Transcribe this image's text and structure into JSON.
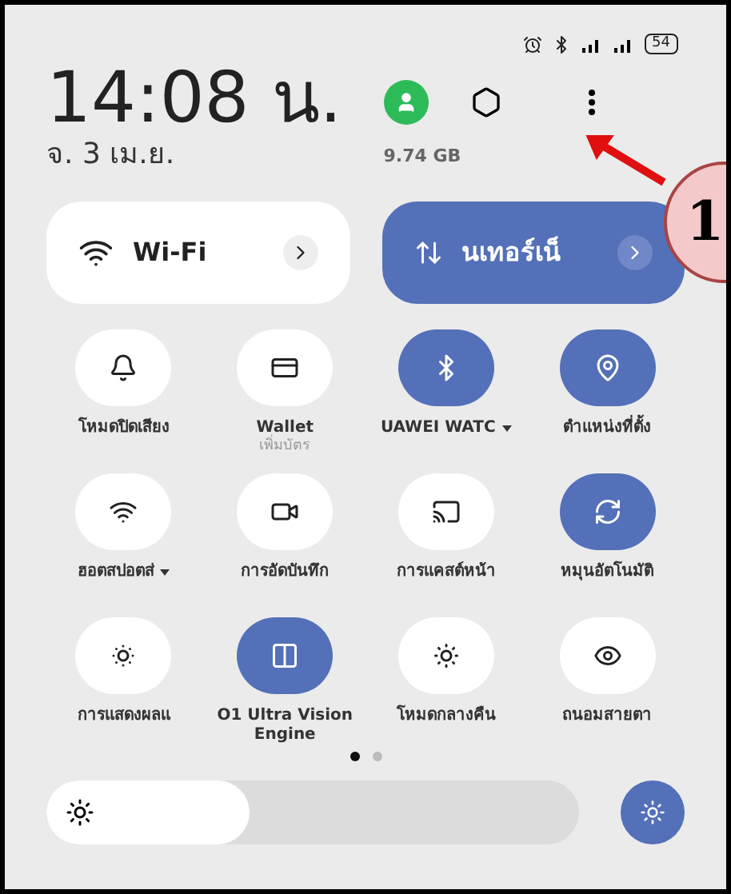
{
  "status_bar": {
    "battery": "54"
  },
  "header": {
    "time": "14:08 น.",
    "date": "จ. 3 เม.ย.",
    "storage": "9.74 GB"
  },
  "big_tiles": [
    {
      "label": "Wi-Fi",
      "on": false
    },
    {
      "label": "นเทอร์เน็",
      "on": true
    }
  ],
  "tiles": [
    {
      "label": "โหมดปิดเสียง",
      "on": false,
      "dropdown": false
    },
    {
      "label": "Wallet",
      "sublabel": "เพิ่มบัตร",
      "on": false,
      "dropdown": false
    },
    {
      "label": "UAWEI WATC",
      "on": true,
      "dropdown": true
    },
    {
      "label": "ตำแหน่งที่ตั้ง",
      "on": true,
      "dropdown": false
    },
    {
      "label": "ฮอตสปอตส่",
      "on": false,
      "dropdown": true
    },
    {
      "label": "การอัดบันทึก",
      "on": false,
      "dropdown": false
    },
    {
      "label": "การแคสต์หน้า",
      "on": false,
      "dropdown": false
    },
    {
      "label": "หมุนอัตโนมัติ",
      "on": true,
      "dropdown": false
    },
    {
      "label": "การแสดงผลแ",
      "on": false,
      "dropdown": false
    },
    {
      "label": "O1 Ultra Vision Engine",
      "on": true,
      "dropdown": false
    },
    {
      "label": "โหมดกลางคืน",
      "on": false,
      "dropdown": false
    },
    {
      "label": "ถนอมสายตา",
      "on": false,
      "dropdown": false
    }
  ],
  "pages": [
    {
      "selected": true
    },
    {
      "selected": false
    }
  ],
  "brightness": {
    "level": 0.38,
    "auto": true
  },
  "annotation": {
    "number": "1"
  }
}
